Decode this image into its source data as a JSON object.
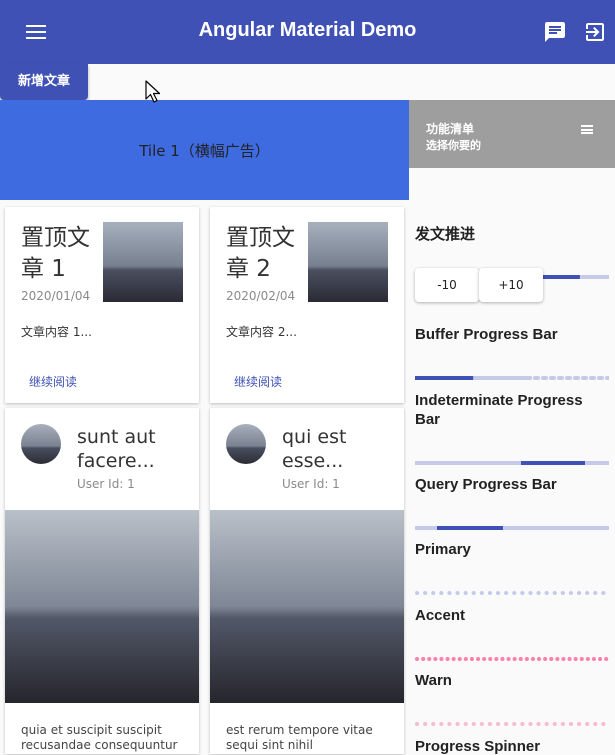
{
  "toolbar": {
    "title": "Angular Material Demo",
    "menu_icon": "menu-icon",
    "chat_icon": "chat-icon",
    "logout_icon": "logout-icon",
    "color": "#3f51b5"
  },
  "actions": {
    "new_post": "新增文章"
  },
  "tiles": {
    "tile1": "Tile 1（横幅广告）",
    "tile2_title": "功能清单",
    "tile2_subtitle": "选择你要的"
  },
  "posts": [
    {
      "title": "置顶文章 1",
      "date": "2020/01/04",
      "body": "文章内容 1...",
      "link": "继续阅读"
    },
    {
      "title": "置顶文章 2",
      "date": "2020/02/04",
      "body": "文章内容 2...",
      "link": "继续阅读"
    }
  ],
  "users": [
    {
      "title": "sunt aut facere...",
      "user_id": "User Id: 1",
      "body": "quia et suscipit suscipit recusandae consequuntur"
    },
    {
      "title": "qui est esse...",
      "user_id": "User Id: 1",
      "body": "est rerum tempore vitae sequi sint nihil"
    }
  ],
  "sidebar": {
    "progress_heading": "发文推进",
    "progress_value": 0.85,
    "minus_label": "-10",
    "plus_label": "+10",
    "buffer_heading": "Buffer Progress Bar",
    "buffer_value": 0.3,
    "buffer_buffer": 0.6,
    "indeterminate_heading": "Indeterminate Progress Bar",
    "query_heading": "Query Progress Bar",
    "primary_heading": "Primary",
    "accent_heading": "Accent",
    "warn_heading": "Warn",
    "spinner_heading": "Progress Spinner",
    "colors": {
      "primary": "#3f51b5",
      "primary_light": "#c5cae9",
      "accent": "#ff80ab",
      "warn": "#f8bbd0"
    }
  }
}
